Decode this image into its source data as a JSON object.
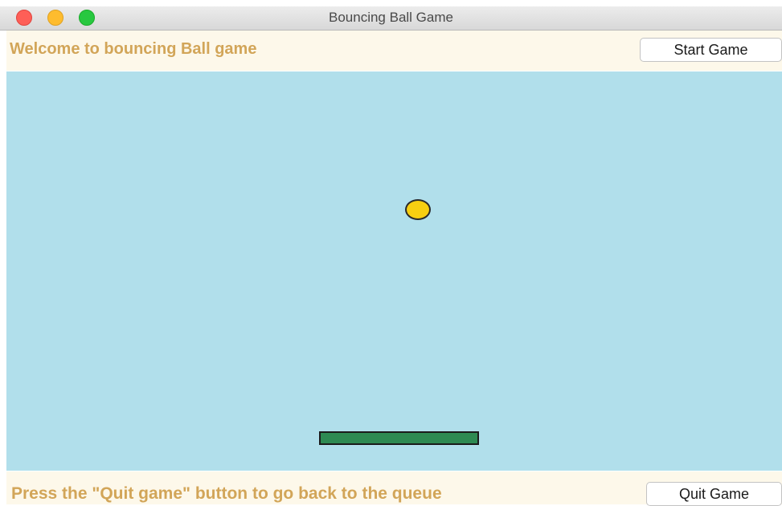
{
  "window": {
    "title": "Bouncing Ball Game"
  },
  "header": {
    "welcome_text": "Welcome to bouncing Ball game",
    "start_button_label": "Start Game"
  },
  "footer": {
    "instruction_text": "Press the \"Quit game\" button to go back to the queue",
    "quit_button_label": "Quit Game"
  },
  "colors": {
    "playfield": "#b1dfeb",
    "panel": "#fdf8ea",
    "text_accent": "#d2a558",
    "ball": "#f7cf11",
    "paddle": "#2e8a52"
  }
}
